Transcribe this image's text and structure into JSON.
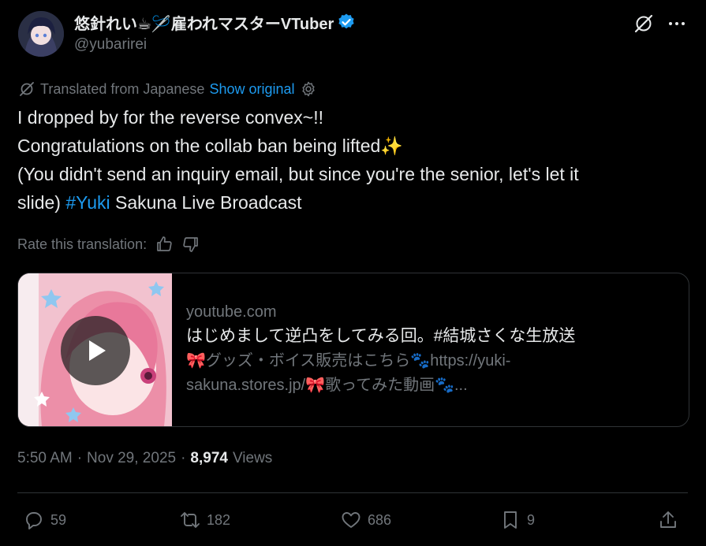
{
  "author": {
    "display_name": "悠針れい☕🪡雇われマスターVTuber",
    "handle": "@yubarirei",
    "verified_color": "#1d9bf0"
  },
  "translation": {
    "label": "Translated from Japanese",
    "show_original": "Show original"
  },
  "tweet": {
    "line1": "I dropped by for the reverse convex~!!",
    "line2_text": "Congratulations on the collab ban being lifted",
    "line2_emoji": "✨",
    "line3_part1": "(You didn't send an inquiry email, but since you're the senior, let's let it",
    "line3_part2": "slide)",
    "hashtag": "#Yuki",
    "line3_tail": "Sakuna Live Broadcast"
  },
  "rate": {
    "label": "Rate this translation:"
  },
  "card": {
    "domain": "youtube.com",
    "title": "はじめまして逆凸をしてみる回。#結城さくな生放送",
    "description_line1": "🎀グッズ・ボイス販売はこちら🐾https://yuki-",
    "description_line2": "sakuna.stores.jp/🎀歌ってみた動画🐾..."
  },
  "meta": {
    "time": "5:50 AM",
    "sep1": "·",
    "date": "Nov 29, 2025",
    "sep2": "·",
    "views_count": "8,974",
    "views_label": "Views"
  },
  "actions": {
    "replies": "59",
    "reposts": "182",
    "likes": "686",
    "bookmarks": "9"
  },
  "colors": {
    "background": "#000000",
    "text": "#e7e9ea",
    "muted": "#71767b",
    "accent": "#1d9bf0",
    "border": "#2f3336"
  }
}
